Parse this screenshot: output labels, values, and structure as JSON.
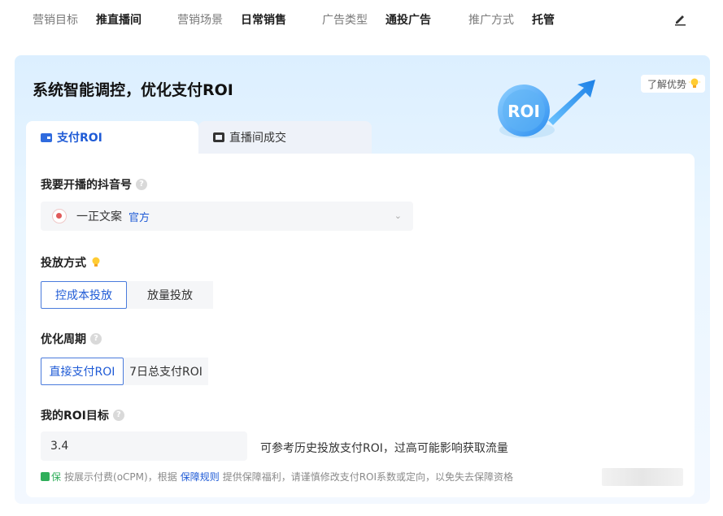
{
  "topbar": {
    "items": [
      {
        "label": "营销目标",
        "value": "推直播间"
      },
      {
        "label": "营销场景",
        "value": "日常销售"
      },
      {
        "label": "广告类型",
        "value": "通投广告"
      },
      {
        "label": "推广方式",
        "value": "托管"
      }
    ],
    "edit_icon": "pencil-icon"
  },
  "card": {
    "title": "系统智能调控，优化支付ROI",
    "learn_label": "了解优势",
    "badge_text": "ROI",
    "tabs": [
      {
        "label": "支付ROI",
        "icon": "wallet-icon",
        "active": true
      },
      {
        "label": "直播间成交",
        "icon": "tv-icon",
        "active": false
      }
    ]
  },
  "form": {
    "account": {
      "label": "我要开播的抖音号",
      "name": "一正文案",
      "tag": "官方"
    },
    "delivery": {
      "label": "投放方式",
      "options": [
        "控成本投放",
        "放量投放"
      ],
      "selected": "控成本投放"
    },
    "period": {
      "label": "优化周期",
      "options": [
        "直接支付ROI",
        "7日总支付ROI"
      ],
      "selected": "直接支付ROI"
    },
    "roi_target": {
      "label": "我的ROI目标",
      "value": "3.4",
      "hint": "可参考历史投放支付ROI，过高可能影响获取流量"
    },
    "footnote": {
      "badge": "保",
      "pre": "按展示付费(oCPM)，根据",
      "link": "保障规则",
      "post": "提供保障福利，请谨慎修改支付ROI系数或定向，以免失去保障资格"
    }
  },
  "colors": {
    "accent": "#1f5bd6",
    "green": "#2fae5a",
    "card_bg_top": "#dcefff"
  }
}
